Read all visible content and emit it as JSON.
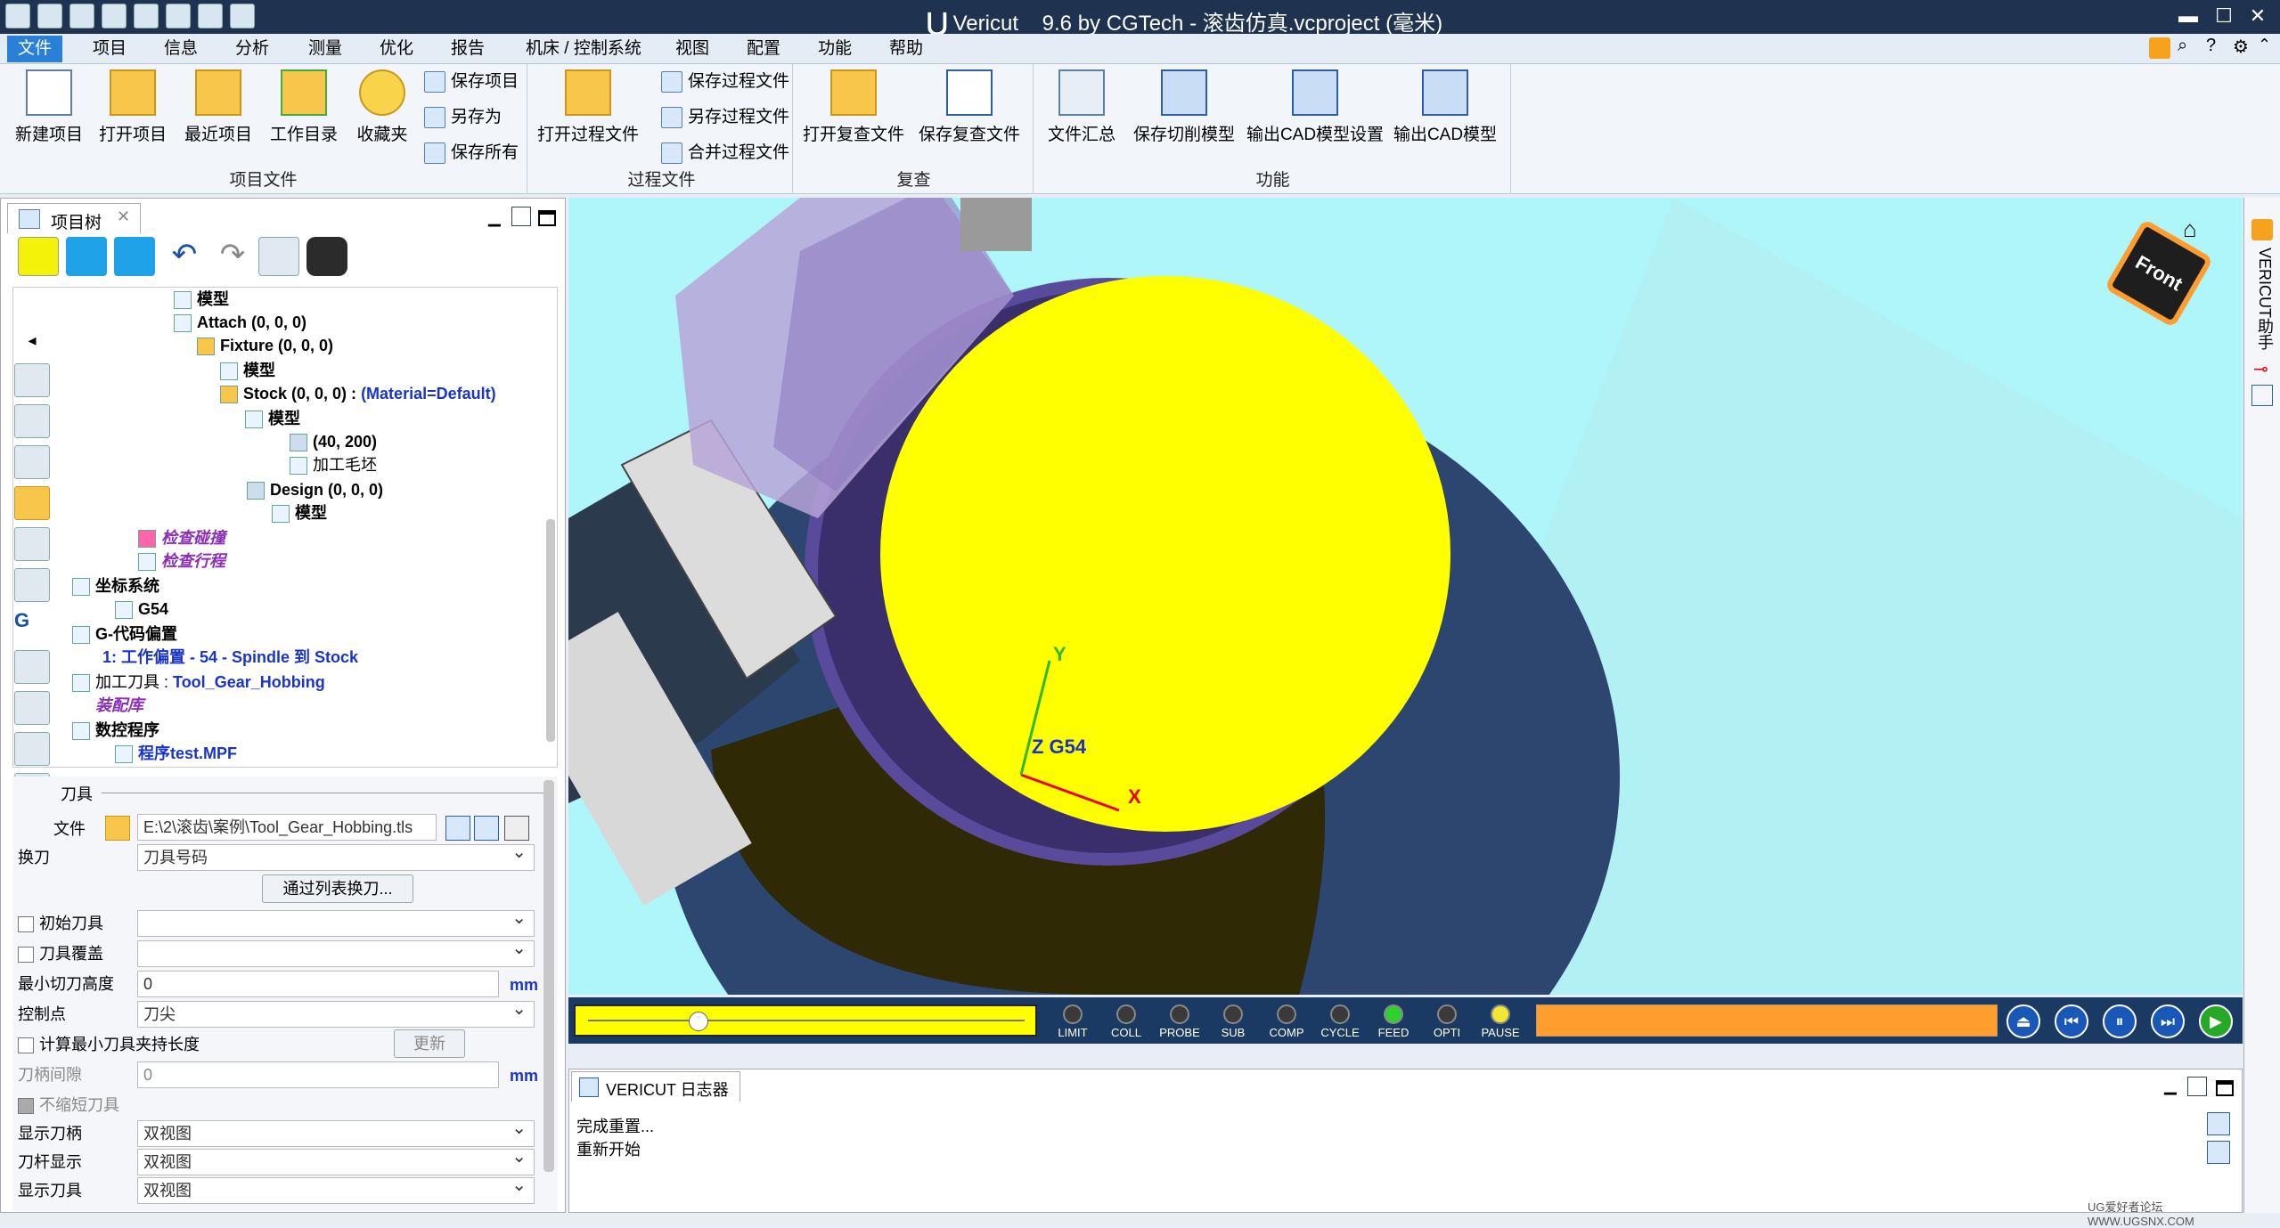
{
  "window": {
    "app_name": "Vericut",
    "title_suffix": "9.6 by CGTech - 滚齿仿真.vcproject (毫米)"
  },
  "menu": [
    "文件",
    "项目",
    "信息",
    "分析",
    "测量",
    "优化",
    "报告",
    "机床 / 控制系统",
    "视图",
    "配置",
    "功能",
    "帮助"
  ],
  "ribbon": {
    "groups": [
      {
        "label": "项目文件",
        "big": [
          "新建项目",
          "打开项目",
          "最近项目",
          "工作目录",
          "收藏夹"
        ],
        "small": [
          "保存项目",
          "另存为",
          "保存所有"
        ]
      },
      {
        "label": "过程文件",
        "big": [
          "打开过程文件"
        ],
        "small": [
          "保存过程文件",
          "另存过程文件",
          "合并过程文件"
        ]
      },
      {
        "label": "复查",
        "big": [
          "打开复查文件",
          "保存复查文件"
        ]
      },
      {
        "label": "功能",
        "big": [
          "文件汇总",
          "保存切削模型",
          "输出CAD模型设置",
          "输出CAD模型"
        ]
      }
    ]
  },
  "project_tree": {
    "tab_label": "项目树",
    "rows": [
      {
        "indent": 0,
        "text": "模型",
        "style": "bold"
      },
      {
        "indent": 1,
        "text": "Attach (0, 0, 0)",
        "style": "bold"
      },
      {
        "indent": 2,
        "text": "Fixture (0, 0, 0)",
        "style": "bold"
      },
      {
        "indent": 3,
        "text": "模型",
        "style": "bold"
      },
      {
        "indent": 3,
        "text": "Stock (0, 0, 0) :",
        "extra": "(Material=Default)",
        "style": "bold"
      },
      {
        "indent": 4,
        "text": "模型",
        "style": "bold"
      },
      {
        "indent": 5,
        "text": "(40, 200)",
        "style": "bold"
      },
      {
        "indent": 5,
        "text": "加工毛坯",
        "style": "normal"
      },
      {
        "indent": 4,
        "text": "Design (0, 0, 0)",
        "style": "bold"
      },
      {
        "indent": 5,
        "text": "模型",
        "style": "bold"
      },
      {
        "indent": 1,
        "text": "检查碰撞",
        "style": "purple"
      },
      {
        "indent": 1,
        "text": "检查行程",
        "style": "purple"
      },
      {
        "indent": 0,
        "text": "坐标系统",
        "style": "bold"
      },
      {
        "indent": 1,
        "text": "G54",
        "style": "bold"
      },
      {
        "indent": 0,
        "text": "G-代码偏置",
        "style": "bold"
      },
      {
        "indent": 1,
        "text": "1: 工作偏置 - 54 - Spindle 到 Stock",
        "style": "blue"
      },
      {
        "indent": 0,
        "text": "加工刀具 :",
        "extra": "Tool_Gear_Hobbing",
        "style": "normal"
      },
      {
        "indent": 0,
        "text": "装配库",
        "style": "purple"
      },
      {
        "indent": 0,
        "text": "数控程序",
        "style": "bold"
      },
      {
        "indent": 1,
        "text": "程序test.MPF",
        "style": "blue"
      }
    ]
  },
  "props": {
    "section": "刀具",
    "file_label": "文件",
    "file_value": "E:\\2\\滚齿\\案例\\Tool_Gear_Hobbing.tls",
    "tool_change_label": "换刀",
    "tool_change_value": "刀具号码",
    "list_button": "通过列表换刀...",
    "initial_tool_label": "初始刀具",
    "tool_override_label": "刀具覆盖",
    "min_cut_label": "最小切刀高度",
    "min_cut_value": "0",
    "unit_mm": "mm",
    "control_point_label": "控制点",
    "control_point_value": "刀尖",
    "calc_min_label": "计算最小刀具夹持长度",
    "update_button": "更新",
    "shank_gap_label": "刀柄间隙",
    "shank_gap_value": "0",
    "no_shorten_label": "不缩短刀具",
    "show_holder_label": "显示刀柄",
    "show_holder_value": "双视图",
    "show_shank_label": "刀杆显示",
    "show_shank_value": "双视图",
    "show_tool_label": "显示刀具",
    "show_tool_value": "双视图"
  },
  "viewport": {
    "cube_label": "Front",
    "axis_y": "Y",
    "axis_x": "X",
    "axis_z": "Z G54",
    "side_label": "VERICUT助手"
  },
  "playback": {
    "slider_position": 0.24,
    "leds": [
      {
        "label": "LIMIT",
        "color": "#3a3a3a"
      },
      {
        "label": "COLL",
        "color": "#3a3a3a"
      },
      {
        "label": "PROBE",
        "color": "#3a3a3a"
      },
      {
        "label": "SUB",
        "color": "#3a3a3a"
      },
      {
        "label": "COMP",
        "color": "#3a3a3a"
      },
      {
        "label": "CYCLE",
        "color": "#3a3a3a"
      },
      {
        "label": "FEED",
        "color": "#2fd12f"
      },
      {
        "label": "OPTI",
        "color": "#3a3a3a"
      },
      {
        "label": "PAUSE",
        "color": "#f2e832"
      }
    ]
  },
  "log": {
    "tab_label": "VERICUT 日志器",
    "lines": [
      "完成重置...",
      "重新开始"
    ]
  },
  "footer": {
    "watermark": "UG爱好者论坛 WWW.UGSNX.COM"
  }
}
